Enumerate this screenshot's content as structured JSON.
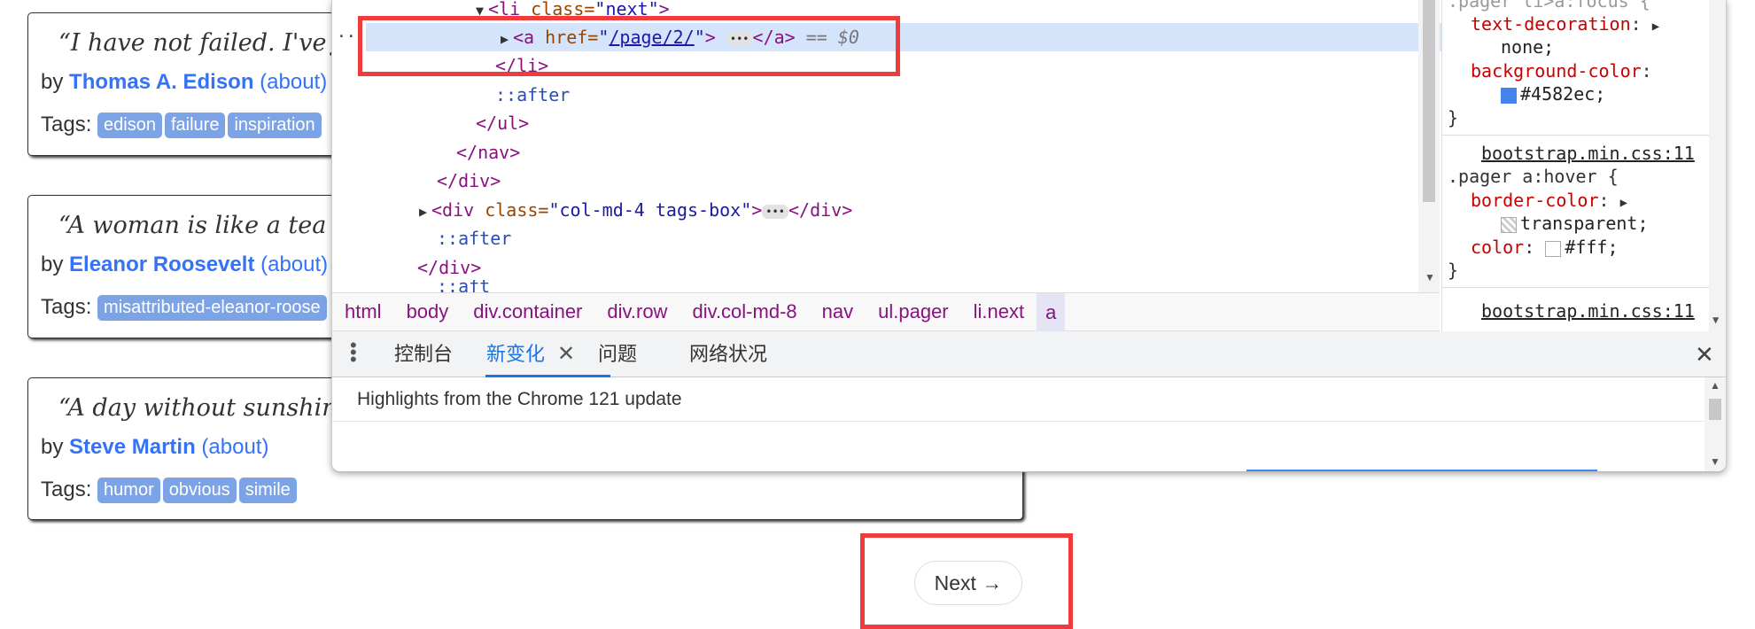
{
  "quotes": [
    {
      "text": "“I have not failed. I've ju",
      "by": "by",
      "author": "Thomas A. Edison",
      "about": "(about)",
      "tags_label": "Tags:",
      "tags": [
        "edison",
        "failure",
        "inspiration"
      ]
    },
    {
      "text": "“A woman is like a tea ba",
      "by": "by",
      "author": "Eleanor Roosevelt",
      "about": "(about)",
      "tags_label": "Tags:",
      "tags": [
        "misattributed-eleanor-roose"
      ]
    },
    {
      "text": "“A day without sunshine",
      "by": "by",
      "author": "Steve Martin",
      "about": "(about)",
      "tags_label": "Tags:",
      "tags": [
        "humor",
        "obvious",
        "simile"
      ]
    }
  ],
  "pager": {
    "next_label": "Next →"
  },
  "devtools": {
    "dom": {
      "li_open": {
        "tag": "<li",
        "attr": " class=",
        "val": "\"next\"",
        "close": ">"
      },
      "a_line": {
        "open": "<a",
        "attr": " href=",
        "q1": "\"",
        "href": "/page/2/",
        "q2": "\"",
        "gt": ">",
        "close": "</a>",
        "eq": "== $0"
      },
      "li_close": "</li>",
      "after1": "::after",
      "ul_close": "</ul>",
      "nav_close": "</nav>",
      "div_close1": "</div>",
      "div_tags": {
        "open": "<div",
        "attr": " class=",
        "val": "\"col-md-4 tags-box\"",
        "gt": ">",
        "close": "</div>"
      },
      "after2": "::after",
      "div_close2": "</div>",
      "partial": "::aft"
    },
    "styles": {
      "rule1_partial": ".pager li>a:focus {",
      "td_name": "text-decoration",
      "td_value": "none;",
      "bg_name": "background-color",
      "bg_value": "#4582ec;",
      "bg_swatch": "#4582ec",
      "brace1": "}",
      "source1": "bootstrap.min.css:11",
      "selector2": ".pager a:hover {",
      "bc_name": "border-color",
      "bc_value": "transparent;",
      "color_name": "color",
      "color_value": "#fff;",
      "brace2": "}",
      "source2": "bootstrap.min.css:11"
    },
    "breadcrumb": [
      "html",
      "body",
      "div.container",
      "div.row",
      "div.col-md-8",
      "nav",
      "ul.pager",
      "li.next",
      "a"
    ],
    "drawer_tabs": {
      "console": "控制台",
      "whats_new": "新变化",
      "issues": "问题",
      "network_conditions": "网络状况"
    },
    "drawer_text": "Highlights from the Chrome 121 update"
  },
  "colors": {
    "highlight_box": "#ef3b3b",
    "link": "#3472f7",
    "tag_bg": "#7ca3e6",
    "accent": "#1a73e8"
  }
}
